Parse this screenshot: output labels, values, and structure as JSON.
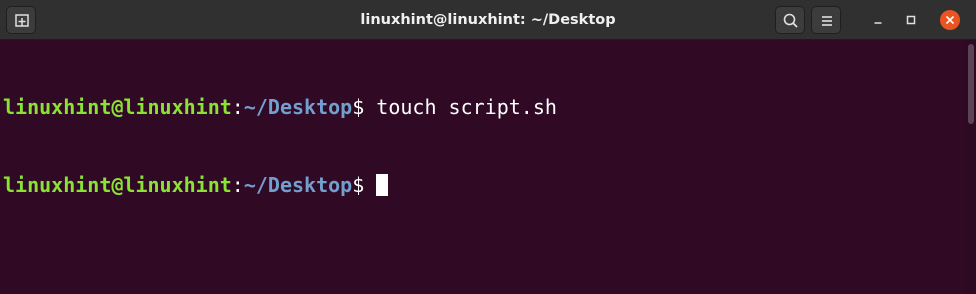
{
  "window": {
    "title": "linuxhint@linuxhint: ~/Desktop"
  },
  "titlebar": {
    "left_icon": "new-tab-icon",
    "right_icons": [
      "search-icon",
      "hamburger-menu-icon",
      "minimize-icon",
      "maximize-icon",
      "close-icon"
    ],
    "close_color": "#e95420"
  },
  "terminal": {
    "background": "#300a24",
    "lines": [
      {
        "user_host": "linuxhint@linuxhint",
        "sep": ":",
        "path": "~/Desktop",
        "prompt": "$ ",
        "command": "touch script.sh"
      },
      {
        "user_host": "linuxhint@linuxhint",
        "sep": ":",
        "path": "~/Desktop",
        "prompt": "$ ",
        "command": ""
      }
    ],
    "colors": {
      "user_host": "#8ae234",
      "path": "#729fcf",
      "text": "#ffffff"
    }
  }
}
